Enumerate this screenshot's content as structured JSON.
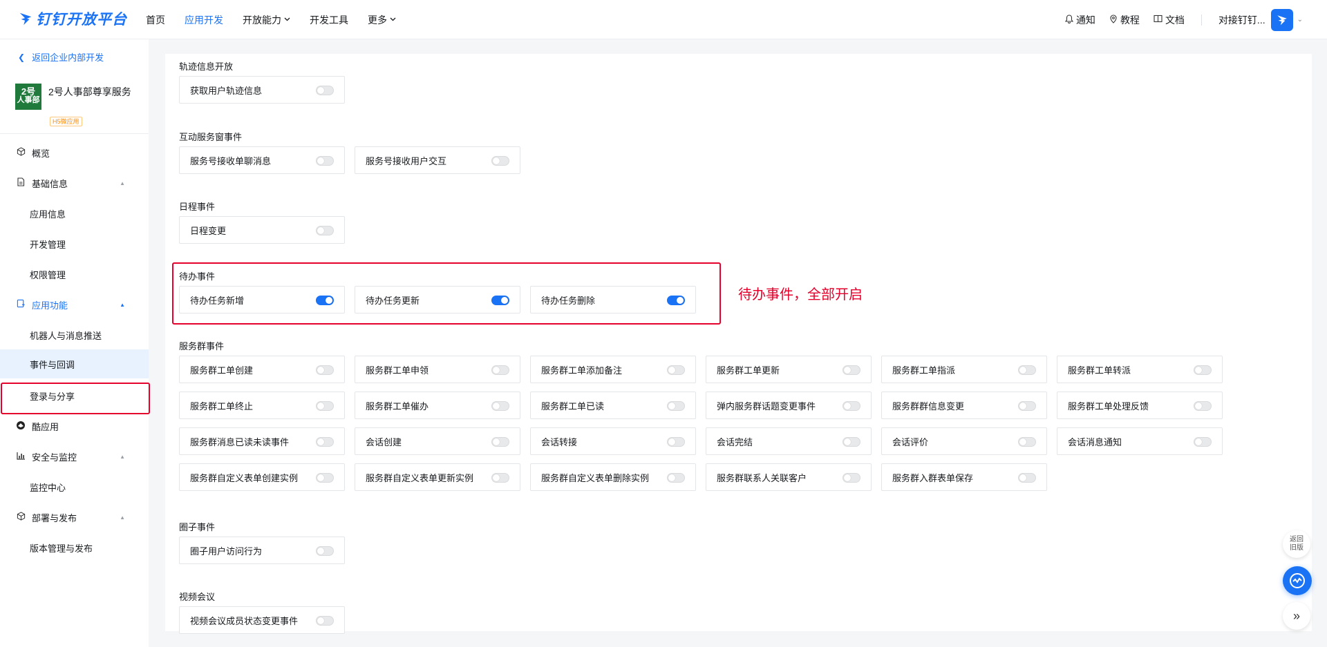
{
  "header": {
    "brand": "钉钉开放平台",
    "nav": [
      {
        "label": "首页",
        "active": false,
        "dropdown": false
      },
      {
        "label": "应用开发",
        "active": true,
        "dropdown": false
      },
      {
        "label": "开放能力",
        "active": false,
        "dropdown": true
      },
      {
        "label": "开发工具",
        "active": false,
        "dropdown": false
      },
      {
        "label": "更多",
        "active": false,
        "dropdown": true
      }
    ],
    "notify": "通知",
    "tutorial": "教程",
    "docs": "文档",
    "org": "对接钉钉..."
  },
  "sidebar": {
    "back": "返回企业内部开发",
    "app": {
      "logo_text_1": "2号",
      "logo_text_2": "人事部",
      "name": "2号人事部尊享服务",
      "tag": "H5微应用"
    },
    "menu": [
      {
        "type": "group",
        "icon": "cube-icon",
        "label": "概览"
      },
      {
        "type": "group",
        "icon": "doc-icon",
        "label": "基础信息",
        "caret": "▲"
      },
      {
        "type": "sub",
        "label": "应用信息"
      },
      {
        "type": "sub",
        "label": "开发管理"
      },
      {
        "type": "sub",
        "label": "权限管理"
      },
      {
        "type": "group",
        "icon": "app-icon",
        "label": "应用功能",
        "caret": "▲",
        "blue": true
      },
      {
        "type": "sub",
        "label": "机器人与消息推送"
      },
      {
        "type": "sub",
        "label": "事件与回调",
        "selected": true
      },
      {
        "type": "sub",
        "label": "登录与分享"
      },
      {
        "type": "group",
        "icon": "cool-app-icon",
        "label": "酷应用"
      },
      {
        "type": "group",
        "icon": "chart-icon",
        "label": "安全与监控",
        "caret": "▲"
      },
      {
        "type": "sub",
        "label": "监控中心"
      },
      {
        "type": "group",
        "icon": "cube-icon",
        "label": "部署与发布",
        "caret": "▲"
      },
      {
        "type": "sub",
        "label": "版本管理与发布"
      }
    ]
  },
  "sections": [
    {
      "title": "轨迹信息开放",
      "events": [
        {
          "label": "获取用户轨迹信息",
          "on": false
        }
      ]
    },
    {
      "title": "互动服务窗事件",
      "events": [
        {
          "label": "服务号接收单聊消息",
          "on": false
        },
        {
          "label": "服务号接收用户交互",
          "on": false
        }
      ]
    },
    {
      "title": "日程事件",
      "events": [
        {
          "label": "日程变更",
          "on": false
        }
      ]
    },
    {
      "title": "待办事件",
      "events": [
        {
          "label": "待办任务新增",
          "on": true
        },
        {
          "label": "待办任务更新",
          "on": true
        },
        {
          "label": "待办任务删除",
          "on": true
        }
      ]
    },
    {
      "title": "服务群事件",
      "events": [
        {
          "label": "服务群工单创建",
          "on": false
        },
        {
          "label": "服务群工单申领",
          "on": false
        },
        {
          "label": "服务群工单添加备注",
          "on": false
        },
        {
          "label": "服务群工单更新",
          "on": false
        },
        {
          "label": "服务群工单指派",
          "on": false
        },
        {
          "label": "服务群工单转派",
          "on": false
        },
        {
          "label": "服务群工单终止",
          "on": false
        },
        {
          "label": "服务群工单催办",
          "on": false
        },
        {
          "label": "服务群工单已读",
          "on": false
        },
        {
          "label": "弹内服务群话题变更事件",
          "on": false
        },
        {
          "label": "服务群群信息变更",
          "on": false
        },
        {
          "label": "服务群工单处理反馈",
          "on": false
        },
        {
          "label": "服务群消息已读未读事件",
          "on": false
        },
        {
          "label": "会话创建",
          "on": false
        },
        {
          "label": "会话转接",
          "on": false
        },
        {
          "label": "会话完结",
          "on": false
        },
        {
          "label": "会话评价",
          "on": false
        },
        {
          "label": "会话消息通知",
          "on": false
        },
        {
          "label": "服务群自定义表单创建实例",
          "on": false
        },
        {
          "label": "服务群自定义表单更新实例",
          "on": false
        },
        {
          "label": "服务群自定义表单删除实例",
          "on": false
        },
        {
          "label": "服务群联系人关联客户",
          "on": false
        },
        {
          "label": "服务群入群表单保存",
          "on": false
        }
      ]
    },
    {
      "title": "圈子事件",
      "events": [
        {
          "label": "圈子用户访问行为",
          "on": false
        }
      ]
    },
    {
      "title": "视频会议",
      "events": [
        {
          "label": "视频会议成员状态变更事件",
          "on": false
        }
      ]
    }
  ],
  "annotation": "待办事件，全部开启",
  "float": {
    "back_line1": "返回",
    "back_line2": "旧版",
    "expand": "»"
  },
  "colors": {
    "accent": "#1a72f5",
    "highlight": "#e4002b",
    "selected_bg": "#e8f1fe"
  }
}
